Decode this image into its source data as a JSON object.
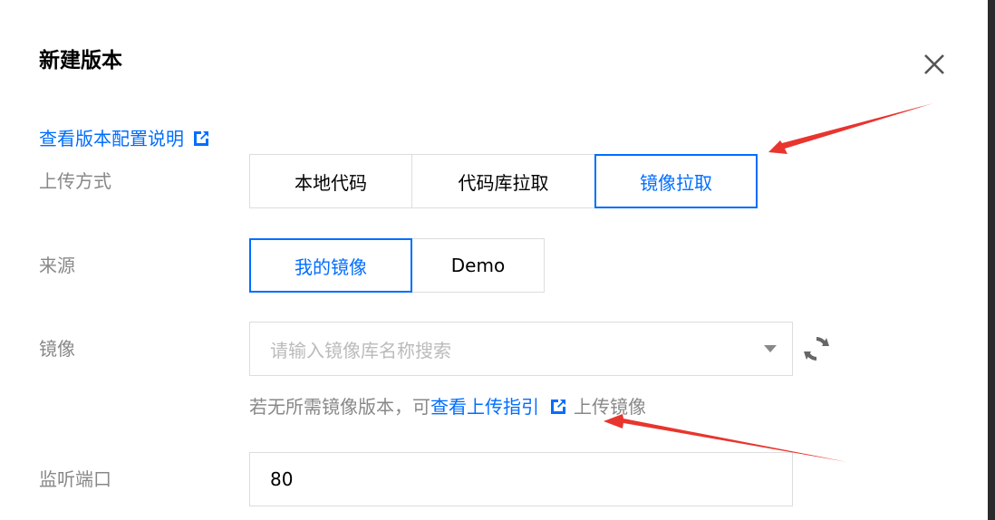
{
  "dialog": {
    "title": "新建版本",
    "doc_link": "查看版本配置说明"
  },
  "upload_method": {
    "label": "上传方式",
    "options": [
      "本地代码",
      "代码库拉取",
      "镜像拉取"
    ],
    "selected": "镜像拉取"
  },
  "source": {
    "label": "来源",
    "options": [
      "我的镜像",
      "Demo"
    ],
    "selected": "我的镜像"
  },
  "image": {
    "label": "镜像",
    "placeholder": "请输入镜像库名称搜索",
    "hint_prefix": "若无所需镜像版本，可",
    "hint_link": "查看上传指引",
    "hint_suffix": "上传镜像"
  },
  "port": {
    "label": "监听端口",
    "value": "80"
  },
  "colors": {
    "accent": "#006eff",
    "annotation_arrow": "#e8352e"
  },
  "icons": [
    "close-icon",
    "external-link-icon",
    "dropdown-arrow-icon",
    "refresh-icon"
  ]
}
